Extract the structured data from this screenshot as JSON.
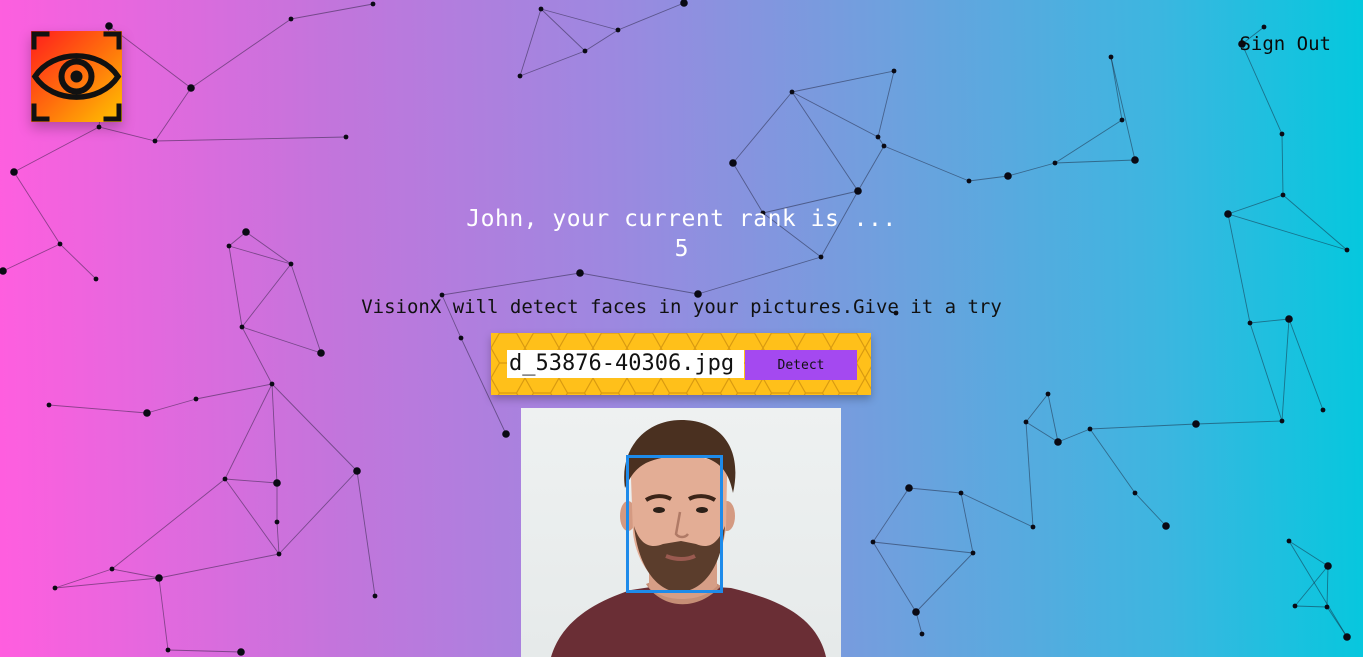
{
  "app": {
    "logo_icon": "eye-scan-icon",
    "logo_colors": [
      "#ff1d1d",
      "#ff6d0d",
      "#ffc400"
    ]
  },
  "nav": {
    "sign_out_label": "Sign Out"
  },
  "rank": {
    "message": "John, your current rank is ...",
    "value": "5"
  },
  "tagline": "VisionX will detect faces in your pictures.Give it a try",
  "form": {
    "image_url_value": "d_53876-40306.jpg",
    "detect_label": "Detect",
    "button_color": "#a449f0",
    "panel_color": "#ffc01a"
  },
  "result": {
    "image_description_icon": "portrait-photo",
    "face_box_color": "#1e8bea",
    "faces_detected": 1
  },
  "colors": {
    "background_start": "#ff5edf",
    "background_end": "#04c8de"
  }
}
